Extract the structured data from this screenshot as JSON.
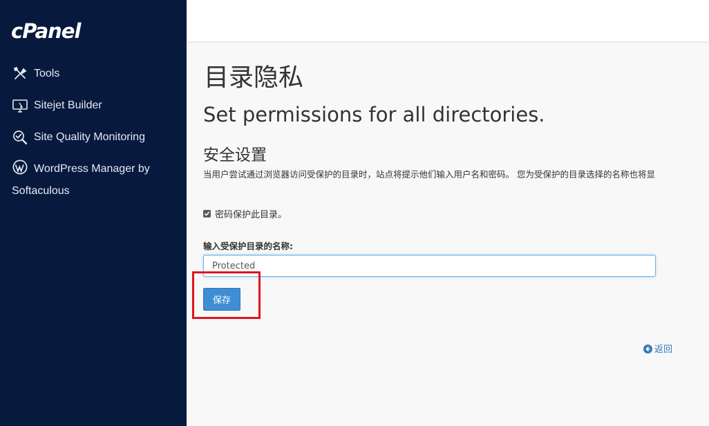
{
  "sidebar": {
    "logo": "cPanel",
    "items": [
      {
        "label": "Tools",
        "icon": "tools-icon"
      },
      {
        "label": "Sitejet Builder",
        "icon": "monitor-icon"
      },
      {
        "label": "Site Quality Monitoring",
        "icon": "magnifier-check-icon"
      },
      {
        "label": "WordPress Manager by Softaculous",
        "icon": "wordpress-icon"
      }
    ]
  },
  "main": {
    "page_title": "目录隐私",
    "subtitle": "Set permissions for all directories.",
    "section_title": "安全设置",
    "description": "当用户尝试通过浏览器访问受保护的目录时，站点将提示他们输入用户名和密码。 您为受保护的目录选择的名称也将显",
    "checkbox_label": "密码保护此目录。",
    "checkbox_checked": true,
    "name_field_label": "输入受保护目录的名称:",
    "name_field_value": "Protected",
    "save_label": "保存",
    "back_label": "返回"
  },
  "colors": {
    "sidebar_bg": "#071a3e",
    "accent": "#3f8ed3",
    "highlight": "#e0141c",
    "link": "#337ab7"
  }
}
